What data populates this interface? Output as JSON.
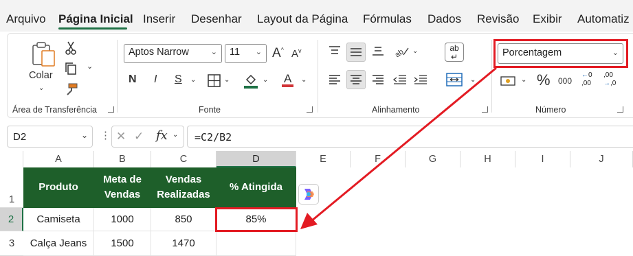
{
  "menu": {
    "tabs": [
      "Arquivo",
      "Página Inicial",
      "Inserir",
      "Desenhar",
      "Layout da Página",
      "Fórmulas",
      "Dados",
      "Revisão",
      "Exibir",
      "Automatiz"
    ]
  },
  "clipboard": {
    "paste_label": "Colar",
    "group_label": "Área de Transferência"
  },
  "font": {
    "family": "Aptos Narrow",
    "size": "11",
    "bold": "N",
    "italic": "I",
    "underline": "S",
    "grow": "A",
    "shrink": "A",
    "color": "A",
    "group_label": "Fonte"
  },
  "alignment": {
    "orientation_label": "ab",
    "group_label": "Alinhamento"
  },
  "number": {
    "format": "Porcentagem",
    "percent": "%",
    "thousands": "000",
    "inc_decimal": ",00",
    "dec_decimal": ",00",
    "group_label": "Número"
  },
  "formula_bar": {
    "cell_ref": "D2",
    "fx": "fx",
    "formula": "=C2/B2"
  },
  "sheet": {
    "columns": [
      "A",
      "B",
      "C",
      "D",
      "E",
      "F",
      "G",
      "H",
      "I",
      "J"
    ],
    "rows": [
      "1",
      "2",
      "3"
    ],
    "header": [
      "Produto",
      "Meta de\nVendas",
      "Vendas\nRealizadas",
      "% Atingida"
    ],
    "data": [
      [
        "Camiseta",
        "1000",
        "850",
        "85%"
      ],
      [
        "Calça Jeans",
        "1500",
        "1470",
        ""
      ]
    ]
  },
  "colors": {
    "accent": "#1e7145",
    "header_fill": "#1e5f2a",
    "highlight": "#e31b23"
  }
}
